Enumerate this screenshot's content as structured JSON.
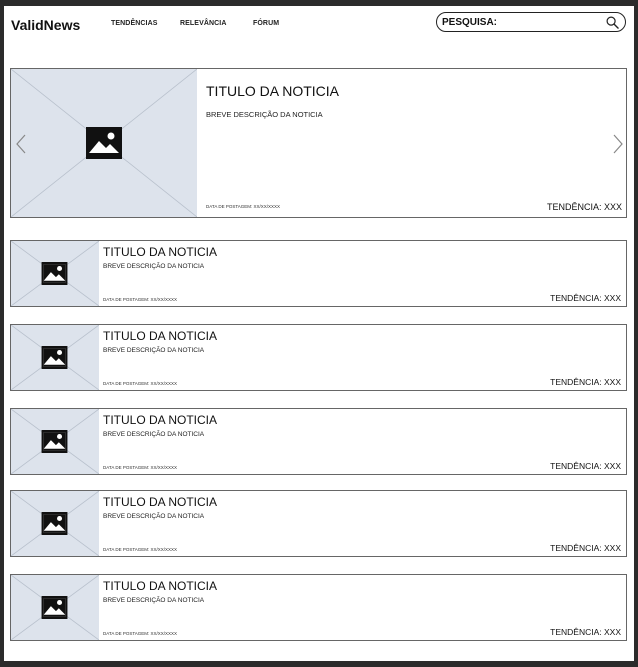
{
  "header": {
    "brand": "ValidNews",
    "nav": [
      "TENDÊNCIAS",
      "RELEVÂNCIA",
      "FÓRUM"
    ],
    "search_label": "PESQUISA:"
  },
  "hero": {
    "title": "TITULO DA NOTICIA",
    "description": "BREVE DESCRIÇÃO DA NOTICIA",
    "date": "DATA DE POSTAGEM: XX/XX/XXXX",
    "trend": "TENDÊNCIA: XXX"
  },
  "news": [
    {
      "title": "TITULO DA NOTICIA",
      "description": "BREVE DESCRIÇÃO DA NOTICIA",
      "date": "DATA DE POSTAGEM: XX/XX/XXXX",
      "trend": "TENDÊNCIA: XXX"
    },
    {
      "title": "TITULO DA NOTICIA",
      "description": "BREVE DESCRIÇÃO DA NOTICIA",
      "date": "DATA DE POSTAGEM: XX/XX/XXXX",
      "trend": "TENDÊNCIA: XXX"
    },
    {
      "title": "TITULO DA NOTICIA",
      "description": "BREVE DESCRIÇÃO DA NOTICIA",
      "date": "DATA DE POSTAGEM: XX/XX/XXXX",
      "trend": "TENDÊNCIA: XXX"
    },
    {
      "title": "TITULO DA NOTICIA",
      "description": "BREVE DESCRIÇÃO DA NOTICIA",
      "date": "DATA DE POSTAGEM: XX/XX/XXXX",
      "trend": "TENDÊNCIA: XXX"
    },
    {
      "title": "TITULO DA NOTICIA",
      "description": "BREVE DESCRIÇÃO DA NOTICIA",
      "date": "DATA DE POSTAGEM: XX/XX/XXXX",
      "trend": "TENDÊNCIA: XXX"
    }
  ],
  "icons": {
    "search": "search-icon",
    "image_placeholder": "image-icon",
    "prev": "chevron-left-icon",
    "next": "chevron-right-icon"
  },
  "colors": {
    "placeholder_bg": "#dde3ec",
    "border": "#666666"
  }
}
